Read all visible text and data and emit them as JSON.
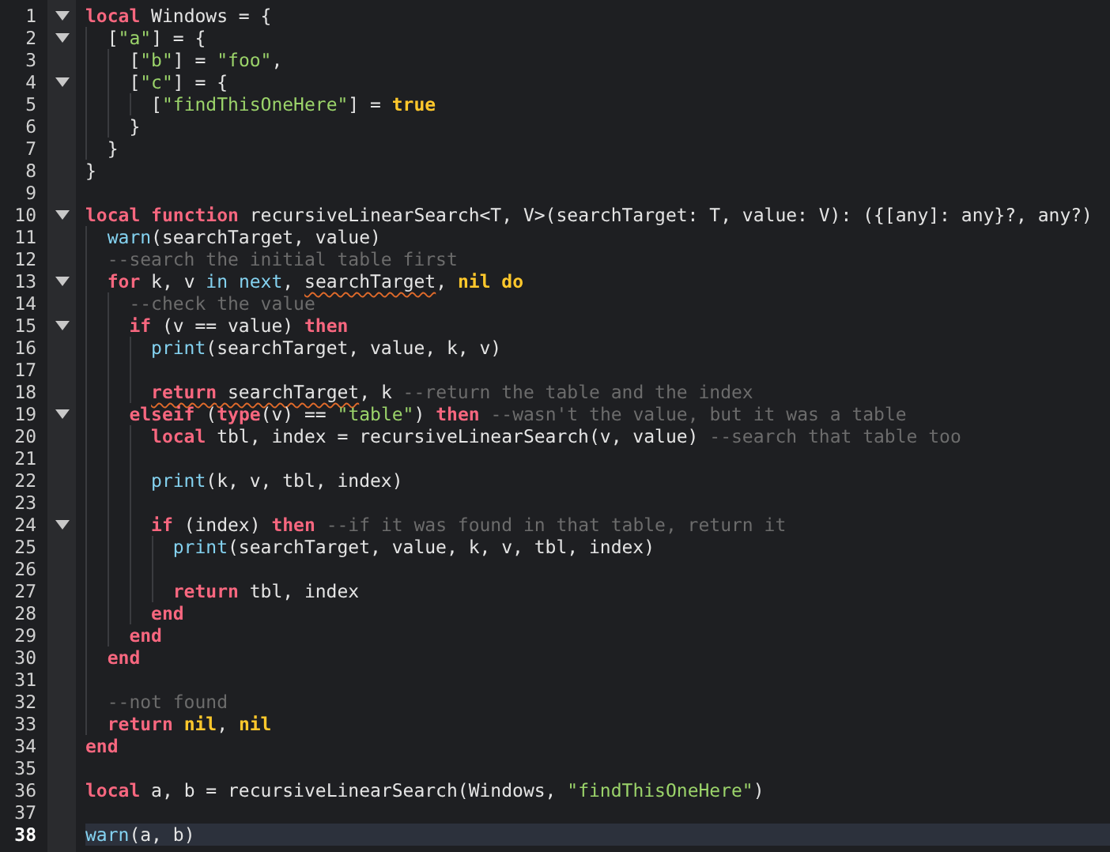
{
  "editor": {
    "lines": [
      {
        "number": "1",
        "expanded": true,
        "tokens": [
          {
            "kind": "keyword",
            "text": "local"
          },
          {
            "kind": "plain",
            "text": " Windows = {"
          }
        ],
        "children": [
          {
            "number": "2",
            "expanded": true,
            "tokens": [
              {
                "kind": "plain",
                "text": "["
              },
              {
                "kind": "string",
                "text": "\"a\""
              },
              {
                "kind": "plain",
                "text": "] = {"
              }
            ],
            "children": [
              {
                "number": "3",
                "tokens": [
                  {
                    "kind": "plain",
                    "text": "["
                  },
                  {
                    "kind": "string",
                    "text": "\"b\""
                  },
                  {
                    "kind": "plain",
                    "text": "] = "
                  },
                  {
                    "kind": "string",
                    "text": "\"foo\""
                  },
                  {
                    "kind": "plain",
                    "text": ","
                  }
                ]
              },
              {
                "number": "4",
                "expanded": true,
                "tokens": [
                  {
                    "kind": "plain",
                    "text": "["
                  },
                  {
                    "kind": "string",
                    "text": "\"c\""
                  },
                  {
                    "kind": "plain",
                    "text": "] = {"
                  }
                ],
                "children": [
                  {
                    "number": "5",
                    "tokens": [
                      {
                        "kind": "plain",
                        "text": "["
                      },
                      {
                        "kind": "string",
                        "text": "\"findThisOneHere\""
                      },
                      {
                        "kind": "plain",
                        "text": "] = "
                      },
                      {
                        "kind": "constant",
                        "text": "true"
                      }
                    ]
                  }
                ]
              },
              {
                "number": "6",
                "tokens": [
                  {
                    "kind": "plain",
                    "text": "}"
                  }
                ]
              }
            ]
          },
          {
            "number": "7",
            "tokens": [
              {
                "kind": "plain",
                "text": "}"
              }
            ]
          }
        ]
      },
      {
        "number": "8",
        "tokens": [
          {
            "kind": "plain",
            "text": "}"
          }
        ]
      },
      {
        "number": "9"
      },
      {
        "number": "10",
        "expanded": true,
        "tokens": [
          {
            "kind": "keyword",
            "text": "local "
          },
          {
            "kind": "keyword",
            "text": "function"
          },
          {
            "kind": "plain",
            "text": " recursiveLinearSearch<T, V>(searchTarget: T, value: V): ({[any]: any}?, any?)"
          }
        ],
        "children": [
          {
            "number": "11",
            "tokens": [
              {
                "kind": "builtin",
                "text": "warn"
              },
              {
                "kind": "plain",
                "text": "(searchTarget, value)"
              }
            ]
          },
          {
            "number": "12",
            "tokens": [
              {
                "kind": "comment",
                "text": "--search the initial table first"
              }
            ]
          },
          {
            "number": "13",
            "expanded": true,
            "tokens": [
              {
                "kind": "keyword",
                "text": "for"
              },
              {
                "kind": "plain",
                "text": " k, v "
              },
              {
                "kind": "builtin",
                "text": "in "
              },
              {
                "kind": "builtin",
                "text": "next"
              },
              {
                "kind": "plain",
                "text": ", "
              },
              {
                "kind": "plain",
                "text": "searchTarget",
                "warning": true
              },
              {
                "kind": "plain",
                "text": ", "
              },
              {
                "kind": "constant",
                "text": "nil "
              },
              {
                "kind": "constant",
                "text": "do"
              }
            ],
            "children": [
              {
                "number": "14",
                "tokens": [
                  {
                    "kind": "comment",
                    "text": "--check the value"
                  }
                ]
              },
              {
                "number": "15",
                "expanded": true,
                "tokens": [
                  {
                    "kind": "keyword",
                    "text": "if"
                  },
                  {
                    "kind": "plain",
                    "text": " (v == value) "
                  },
                  {
                    "kind": "keyword",
                    "text": "then"
                  }
                ],
                "children": [
                  {
                    "number": "16",
                    "tokens": [
                      {
                        "kind": "builtin",
                        "text": "print"
                      },
                      {
                        "kind": "plain",
                        "text": "(searchTarget, value, k, v)"
                      }
                    ]
                  },
                  {
                    "number": "17"
                  },
                  {
                    "number": "18",
                    "tokens": [
                      {
                        "kind": "keyword",
                        "text": "return",
                        "warning": true
                      },
                      {
                        "kind": "plain",
                        "text": " searchTarget",
                        "warning": true
                      },
                      {
                        "kind": "plain",
                        "text": ", k "
                      },
                      {
                        "kind": "comment",
                        "text": "--return the table and the index"
                      }
                    ]
                  }
                ]
              },
              {
                "number": "19",
                "expanded": true,
                "tokens": [
                  {
                    "kind": "keyword",
                    "text": "elseif"
                  },
                  {
                    "kind": "plain",
                    "text": " ("
                  },
                  {
                    "kind": "keyword",
                    "text": "type"
                  },
                  {
                    "kind": "plain",
                    "text": "(v) == "
                  },
                  {
                    "kind": "string",
                    "text": "\"table\""
                  },
                  {
                    "kind": "plain",
                    "text": ") "
                  },
                  {
                    "kind": "keyword",
                    "text": "then "
                  },
                  {
                    "kind": "comment",
                    "text": "--wasn't the value, but it was a table"
                  }
                ],
                "children": [
                  {
                    "number": "20",
                    "tokens": [
                      {
                        "kind": "keyword",
                        "text": "local"
                      },
                      {
                        "kind": "plain",
                        "text": " tbl, index = recursiveLinearSearch(v, value) "
                      },
                      {
                        "kind": "comment",
                        "text": "--search that table too"
                      }
                    ]
                  },
                  {
                    "number": "21"
                  },
                  {
                    "number": "22",
                    "tokens": [
                      {
                        "kind": "builtin",
                        "text": "print"
                      },
                      {
                        "kind": "plain",
                        "text": "(k, v, tbl, index)"
                      }
                    ]
                  },
                  {
                    "number": "23"
                  },
                  {
                    "number": "24",
                    "expanded": true,
                    "tokens": [
                      {
                        "kind": "keyword",
                        "text": "if"
                      },
                      {
                        "kind": "plain",
                        "text": " (index) "
                      },
                      {
                        "kind": "keyword",
                        "text": "then "
                      },
                      {
                        "kind": "comment",
                        "text": "--if it was found in that table, return it"
                      }
                    ],
                    "children": [
                      {
                        "number": "25",
                        "tokens": [
                          {
                            "kind": "builtin",
                            "text": "print"
                          },
                          {
                            "kind": "plain",
                            "text": "(searchTarget, value, k, v, tbl, index)"
                          }
                        ]
                      },
                      {
                        "number": "26"
                      },
                      {
                        "number": "27",
                        "tokens": [
                          {
                            "kind": "keyword",
                            "text": "return"
                          },
                          {
                            "kind": "plain",
                            "text": " tbl, index"
                          }
                        ]
                      }
                    ]
                  },
                  {
                    "number": "28",
                    "tokens": [
                      {
                        "kind": "keyword",
                        "text": "end"
                      }
                    ]
                  }
                ]
              },
              {
                "number": "29",
                "tokens": [
                  {
                    "kind": "keyword",
                    "text": "end"
                  }
                ]
              }
            ]
          },
          {
            "number": "30",
            "tokens": [
              {
                "kind": "keyword",
                "text": "end"
              }
            ]
          },
          {
            "number": "31"
          },
          {
            "number": "32",
            "tokens": [
              {
                "kind": "comment",
                "text": "--not found"
              }
            ]
          },
          {
            "number": "33",
            "tokens": [
              {
                "kind": "keyword",
                "text": "return "
              },
              {
                "kind": "constant",
                "text": "nil"
              },
              {
                "kind": "plain",
                "text": ", "
              },
              {
                "kind": "constant",
                "text": "nil"
              }
            ]
          }
        ]
      },
      {
        "number": "34",
        "tokens": [
          {
            "kind": "keyword",
            "text": "end"
          }
        ]
      },
      {
        "number": "35"
      },
      {
        "number": "36",
        "tokens": [
          {
            "kind": "keyword",
            "text": "local"
          },
          {
            "kind": "plain",
            "text": " a, b = recursiveLinearSearch(Windows, "
          },
          {
            "kind": "string",
            "text": "\"findThisOneHere\""
          },
          {
            "kind": "plain",
            "text": ")"
          }
        ]
      },
      {
        "number": "37"
      },
      {
        "number": "38",
        "current": true,
        "tokens": [
          {
            "kind": "builtin",
            "text": "warn"
          },
          {
            "kind": "plain",
            "text": "(a, b)"
          }
        ]
      }
    ]
  }
}
